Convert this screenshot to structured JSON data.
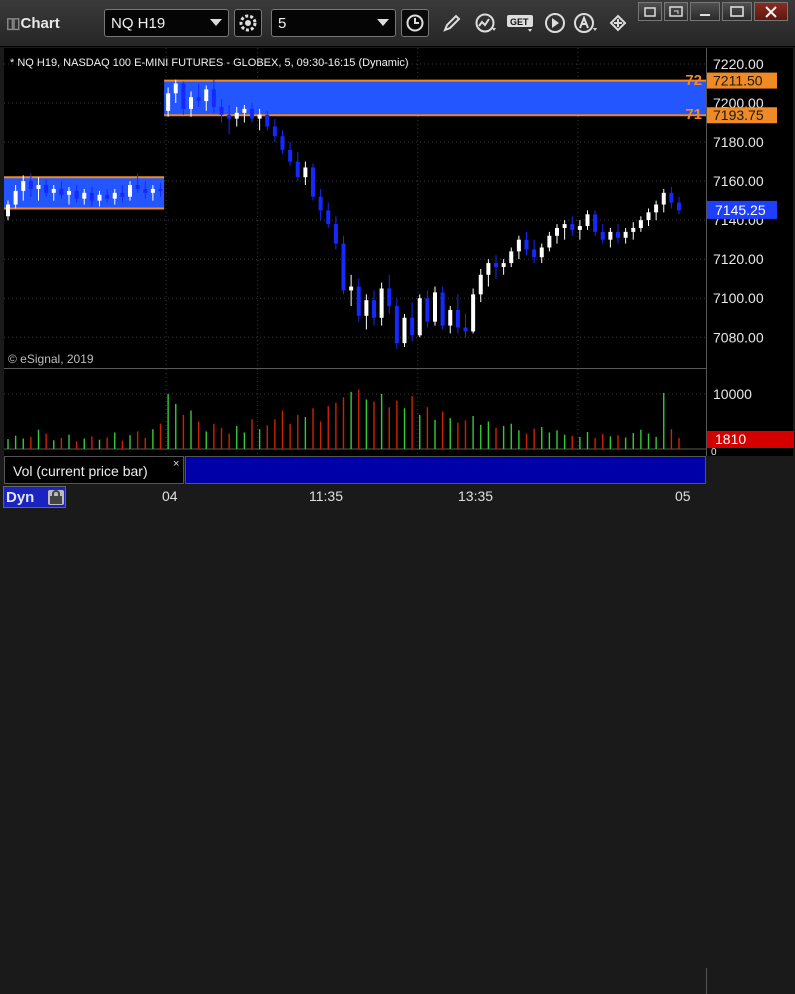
{
  "window": {
    "title": "Chart"
  },
  "toolbar": {
    "symbol": "NQ H19",
    "interval": "5",
    "button_get_label": "GET"
  },
  "chart": {
    "header": "* NQ H19, NASDAQ 100 E-MINI FUTURES - GLOBEX, 5, 09:30-16:15 (Dynamic)",
    "copyright": "© eSignal, 2019",
    "price_ticks": [
      "7220.00",
      "7200.00",
      "7180.00",
      "7160.00",
      "7140.00",
      "7120.00",
      "7100.00",
      "7080.00"
    ],
    "price_tick_values": [
      7220,
      7200,
      7180,
      7160,
      7140,
      7120,
      7100,
      7080
    ],
    "upper_zone": {
      "top": 7211.5,
      "bottom": 7193.75
    },
    "left_zone": {
      "top": 7162,
      "bottom": 7146
    },
    "markers": [
      {
        "label": "72",
        "price": "7211.50",
        "value": 7211.5
      },
      {
        "label": "71",
        "price": "7193.75",
        "value": 7193.75
      }
    ],
    "current_price": "7145.25",
    "current_price_value": 7145.25,
    "price_range": [
      7072,
      7230
    ],
    "colors": {
      "zone": "#2456ff",
      "zone_line": "#f08a24",
      "up": "#ffffff",
      "down": "#1428ff",
      "marker": "#f08a24",
      "current": "#1d3fff"
    }
  },
  "volume": {
    "label": "Vol (current price bar)",
    "close_glyph": "×",
    "ticks": [
      "10000",
      "0"
    ],
    "current": "1810",
    "colors": {
      "up": "#33cc33",
      "down": "#cc2200",
      "current": "#d40000"
    }
  },
  "time_axis": {
    "mode": "Dyn",
    "labels": [
      "04",
      "11:35",
      "13:35",
      "05"
    ]
  },
  "chart_data": {
    "type": "candlestick",
    "y_range": [
      7072,
      7230
    ],
    "session_break_index": 21,
    "candles": [
      [
        7142,
        7150,
        7140,
        7148
      ],
      [
        7148,
        7158,
        7146,
        7155
      ],
      [
        7155,
        7163,
        7150,
        7160
      ],
      [
        7160,
        7164,
        7152,
        7156
      ],
      [
        7156,
        7162,
        7150,
        7158
      ],
      [
        7158,
        7161,
        7152,
        7154
      ],
      [
        7154,
        7158,
        7150,
        7156
      ],
      [
        7156,
        7160,
        7151,
        7153
      ],
      [
        7153,
        7157,
        7148,
        7155
      ],
      [
        7155,
        7158,
        7149,
        7151
      ],
      [
        7151,
        7156,
        7148,
        7154
      ],
      [
        7154,
        7157,
        7147,
        7150
      ],
      [
        7150,
        7155,
        7147,
        7153
      ],
      [
        7153,
        7156,
        7149,
        7151
      ],
      [
        7151,
        7156,
        7148,
        7154
      ],
      [
        7154,
        7158,
        7149,
        7152
      ],
      [
        7152,
        7160,
        7150,
        7158
      ],
      [
        7158,
        7164,
        7154,
        7156
      ],
      [
        7156,
        7160,
        7151,
        7154
      ],
      [
        7154,
        7158,
        7150,
        7156
      ],
      [
        7156,
        7159,
        7152,
        7155
      ],
      [
        7196,
        7208,
        7193,
        7205
      ],
      [
        7205,
        7212,
        7200,
        7210
      ],
      [
        7210,
        7211,
        7194,
        7197
      ],
      [
        7197,
        7206,
        7193,
        7203
      ],
      [
        7203,
        7210,
        7198,
        7201
      ],
      [
        7201,
        7209,
        7196,
        7207
      ],
      [
        7207,
        7212,
        7195,
        7198
      ],
      [
        7198,
        7202,
        7190,
        7194
      ],
      [
        7194,
        7199,
        7184,
        7192
      ],
      [
        7192,
        7198,
        7188,
        7195
      ],
      [
        7195,
        7199,
        7190,
        7197
      ],
      [
        7197,
        7200,
        7190,
        7192
      ],
      [
        7192,
        7197,
        7186,
        7194
      ],
      [
        7194,
        7196,
        7186,
        7188
      ],
      [
        7188,
        7192,
        7180,
        7183
      ],
      [
        7183,
        7186,
        7174,
        7176
      ],
      [
        7176,
        7180,
        7168,
        7170
      ],
      [
        7170,
        7175,
        7160,
        7162
      ],
      [
        7162,
        7170,
        7158,
        7167
      ],
      [
        7167,
        7169,
        7150,
        7152
      ],
      [
        7152,
        7156,
        7140,
        7145
      ],
      [
        7145,
        7149,
        7136,
        7138
      ],
      [
        7138,
        7142,
        7125,
        7128
      ],
      [
        7128,
        7132,
        7102,
        7104
      ],
      [
        7104,
        7112,
        7096,
        7106
      ],
      [
        7106,
        7110,
        7088,
        7091
      ],
      [
        7091,
        7102,
        7084,
        7099
      ],
      [
        7099,
        7104,
        7086,
        7090
      ],
      [
        7090,
        7108,
        7086,
        7105
      ],
      [
        7105,
        7112,
        7092,
        7096
      ],
      [
        7096,
        7100,
        7074,
        7077
      ],
      [
        7077,
        7092,
        7075,
        7090
      ],
      [
        7090,
        7098,
        7078,
        7081
      ],
      [
        7081,
        7102,
        7080,
        7100
      ],
      [
        7100,
        7104,
        7085,
        7088
      ],
      [
        7088,
        7106,
        7086,
        7103
      ],
      [
        7103,
        7106,
        7084,
        7086
      ],
      [
        7086,
        7096,
        7082,
        7094
      ],
      [
        7094,
        7102,
        7082,
        7085
      ],
      [
        7085,
        7092,
        7080,
        7083
      ],
      [
        7083,
        7105,
        7082,
        7102
      ],
      [
        7102,
        7115,
        7098,
        7112
      ],
      [
        7112,
        7120,
        7106,
        7118
      ],
      [
        7118,
        7122,
        7110,
        7116
      ],
      [
        7116,
        7120,
        7112,
        7118
      ],
      [
        7118,
        7126,
        7116,
        7124
      ],
      [
        7124,
        7132,
        7120,
        7130
      ],
      [
        7130,
        7134,
        7122,
        7125
      ],
      [
        7125,
        7130,
        7118,
        7121
      ],
      [
        7121,
        7128,
        7118,
        7126
      ],
      [
        7126,
        7134,
        7124,
        7132
      ],
      [
        7132,
        7138,
        7128,
        7136
      ],
      [
        7136,
        7140,
        7130,
        7138
      ],
      [
        7138,
        7142,
        7132,
        7135
      ],
      [
        7135,
        7140,
        7130,
        7137
      ],
      [
        7137,
        7145,
        7135,
        7143
      ],
      [
        7143,
        7145,
        7132,
        7134
      ],
      [
        7134,
        7138,
        7128,
        7130
      ],
      [
        7130,
        7136,
        7126,
        7134
      ],
      [
        7134,
        7138,
        7128,
        7131
      ],
      [
        7131,
        7136,
        7128,
        7134
      ],
      [
        7134,
        7139,
        7130,
        7136
      ],
      [
        7136,
        7142,
        7134,
        7140
      ],
      [
        7140,
        7146,
        7137,
        7144
      ],
      [
        7144,
        7150,
        7140,
        7148
      ],
      [
        7148,
        7156,
        7144,
        7154
      ],
      [
        7154,
        7157,
        7146,
        7149
      ],
      [
        7149,
        7152,
        7143,
        7145
      ]
    ],
    "volume": [
      1800,
      2400,
      1900,
      2200,
      3500,
      2800,
      1600,
      2000,
      2600,
      1400,
      1900,
      2300,
      1700,
      2100,
      3000,
      1500,
      2500,
      3200,
      2000,
      3600,
      4600,
      10000,
      8200,
      6200,
      7000,
      5000,
      3200,
      4600,
      3800,
      2800,
      4200,
      3000,
      5400,
      3600,
      4300,
      5400,
      7000,
      4600,
      6200,
      5800,
      7400,
      5000,
      7800,
      8400,
      9400,
      10400,
      10800,
      9000,
      8600,
      10000,
      7600,
      8800,
      7400,
      9600,
      6200,
      7600,
      5300,
      6800,
      5600,
      4800,
      5200,
      6000,
      4400,
      5000,
      3800,
      4200,
      4600,
      3400,
      2800,
      3700,
      4000,
      3000,
      3400,
      2600,
      2400,
      2200,
      3100,
      2000,
      2700,
      2300,
      2500,
      2100,
      2900,
      3500,
      2800,
      2200,
      10200,
      3600,
      2000
    ]
  }
}
